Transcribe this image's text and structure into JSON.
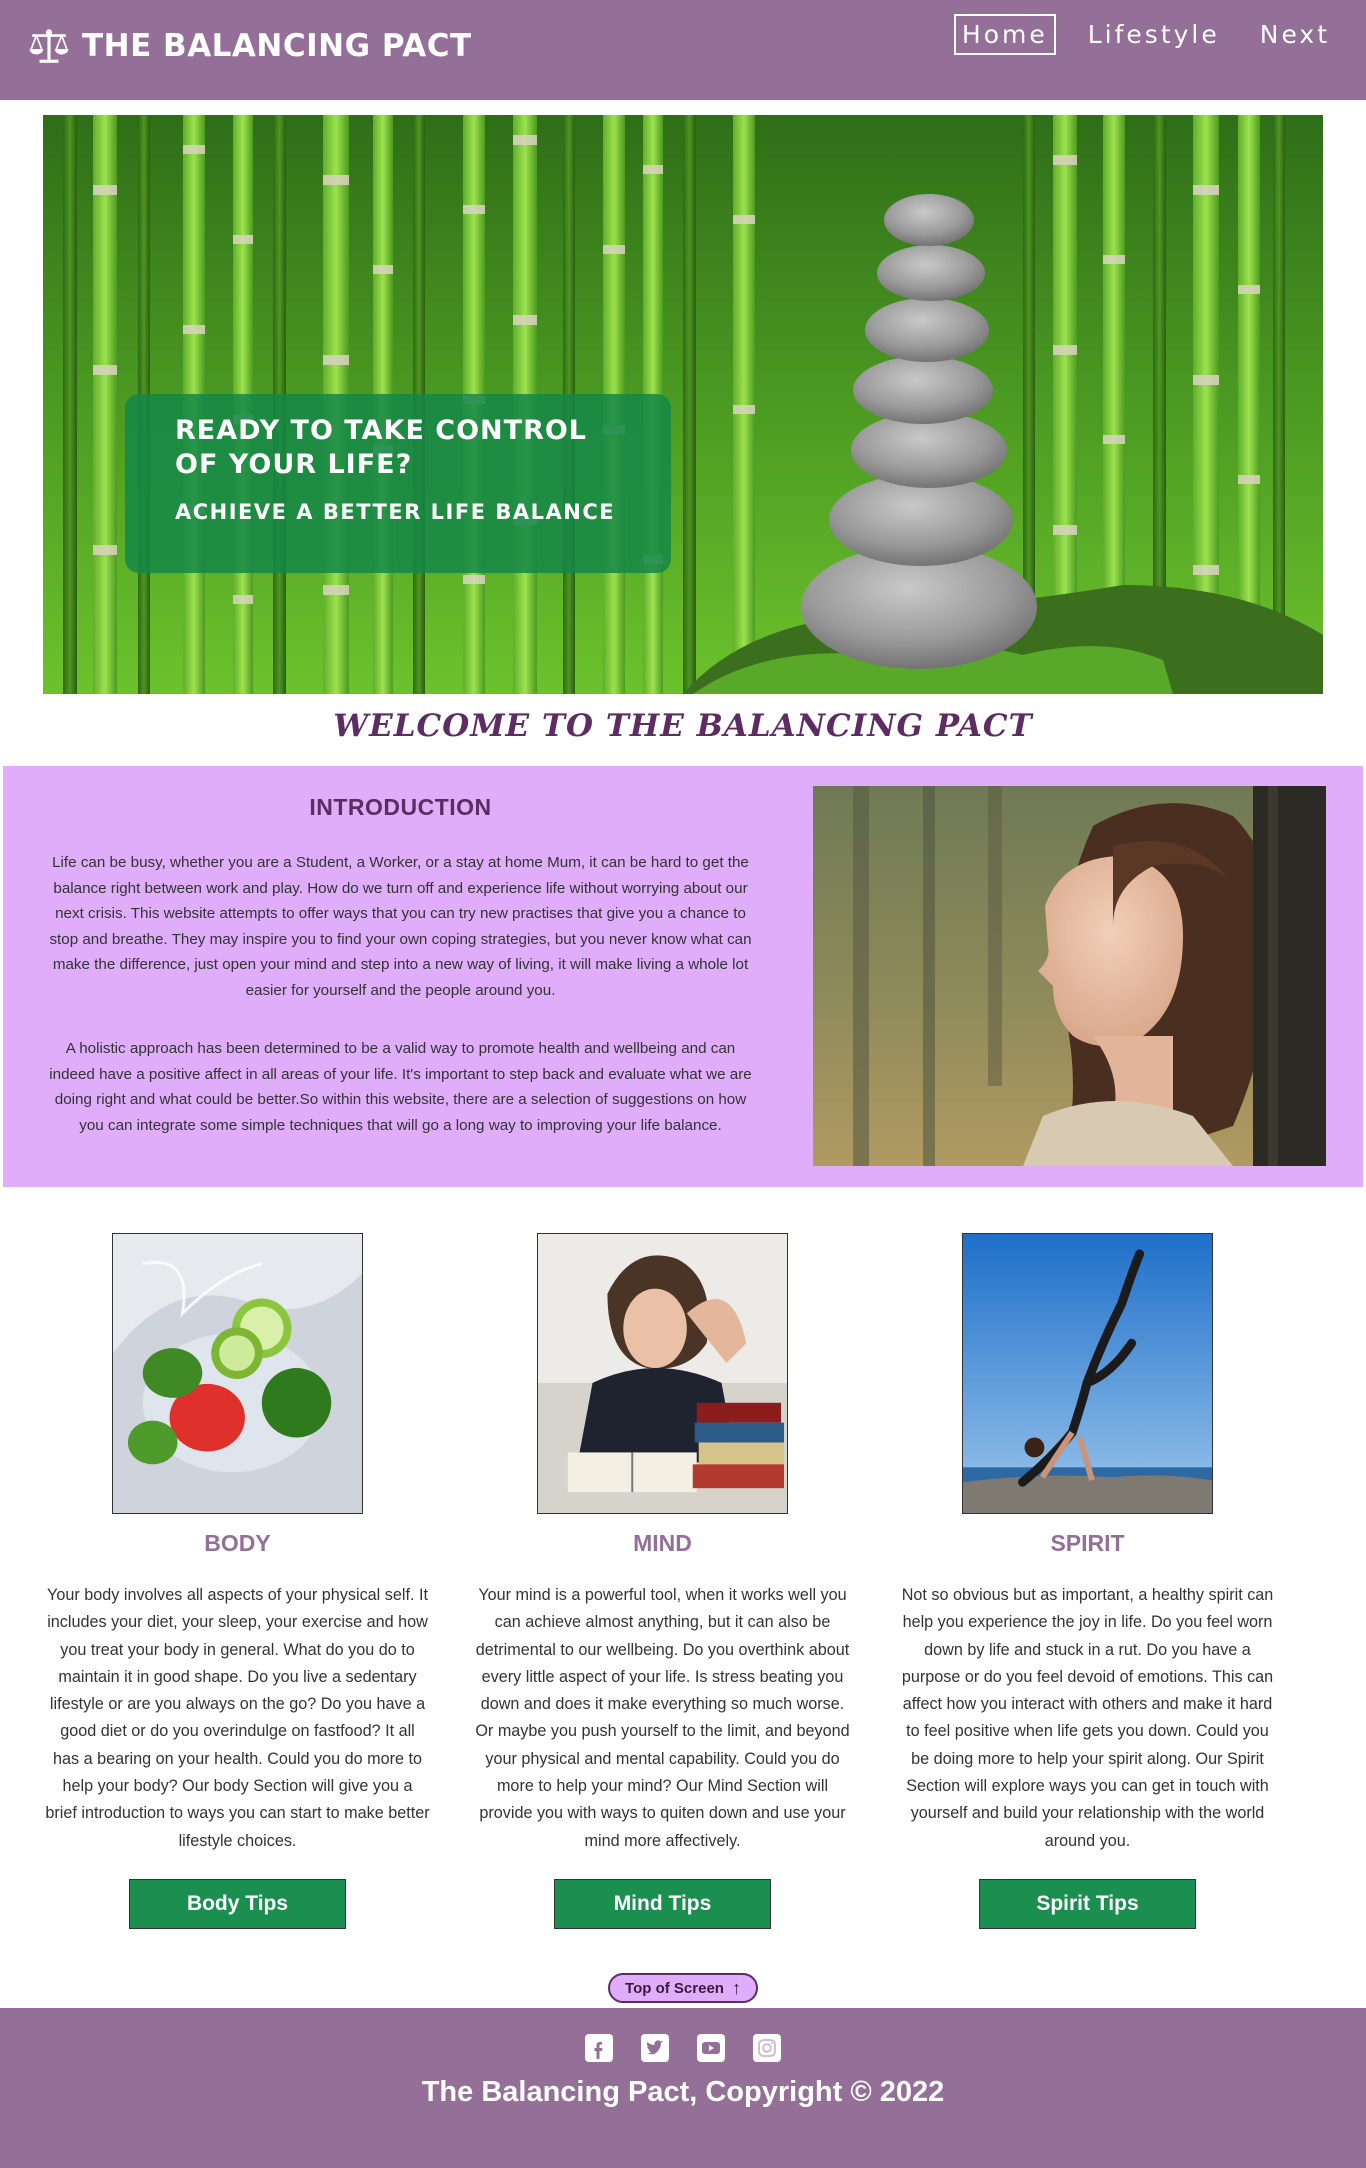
{
  "nav": {
    "brand": "THE BALANCING PACT",
    "brand_icon": "balance-scale-icon",
    "links": [
      {
        "label": "Home",
        "active": true
      },
      {
        "label": "Lifestyle",
        "active": false
      },
      {
        "label": "Next",
        "active": false
      }
    ]
  },
  "hero": {
    "title": "READY TO TAKE CONTROL OF YOUR LIFE?",
    "subtitle": "ACHIEVE A BETTER LIFE BALANCE",
    "image": "stacked zen stones in front of bamboo"
  },
  "welcome": "WELCOME TO THE BALANCING PACT",
  "intro": {
    "title": "INTRODUCTION",
    "paragraphs": [
      "Life can be busy, whether you are a Student, a Worker, or a stay at home Mum, it can be hard to get the balance right between work and play. How do we turn off and experience life without worrying about our next crisis. This website attempts to offer ways that you can try new practises that give you a chance to stop and breathe. They may inspire you to find your own coping strategies, but you never know what can make the difference, just open your mind and step into a new way of living, it will make living a whole lot easier for yourself and the people around you.",
      "A holistic approach has been determined to be a valid way to promote health and wellbeing and can indeed have a positive affect in all areas of your life. It's important to step back and evaluate what we are doing right and what could be better.So within this website, there are a selection of suggestions on how you can integrate some simple techniques that will go a long way to improving your life balance."
    ]
  },
  "cards": [
    {
      "title": "BODY",
      "text": "Your body involves all aspects of your physical self. It includes your diet, your sleep, your exercise and how you treat your body in general. What do you do to maintain it in good shape. Do you live a sedentary lifestyle or are you always on the go? Do you have a good diet or do you overindulge on fastfood? It all has a bearing on your health. Could you do more to help your body? Our body Section will give you a brief introduction to ways you can start to make better lifestyle choices.",
      "button": "Body Tips"
    },
    {
      "title": "MIND",
      "text": "Your mind is a powerful tool, when it works well you can achieve almost anything, but it can also be detrimental to our wellbeing. Do you overthink about every little aspect of your life. Is stress beating you down and does it make everything so much worse. Or maybe you push yourself to the limit, and beyond your physical and mental capability. Could you do more to help your mind? Our Mind Section will provide you with ways to quiten down and use your mind more affectively.",
      "button": "Mind Tips"
    },
    {
      "title": "SPIRIT",
      "text": "Not so obvious but as important, a healthy spirit can help you experience the joy in life. Do you feel worn down by life and stuck in a rut. Do you have a purpose or do you feel devoid of emotions. This can affect how you interact with others and make it hard to feel positive when life gets you down. Could you be doing more to help your spirit along. Our Spirit Section will explore ways you can get in touch with yourself and build your relationship with the world around you.",
      "button": "Spirit Tips"
    }
  ],
  "top_button": {
    "label": "Top of Screen",
    "icon": "arrow-up-icon"
  },
  "footer": {
    "socials": [
      "facebook-icon",
      "twitter-icon",
      "youtube-icon",
      "instagram-icon"
    ],
    "copyright": "The Balancing Pact, Copyright © 2022"
  },
  "colors": {
    "nav_purple": "#946f98",
    "intro_lilac": "#dfadf9",
    "heading_plum": "#5c2c63",
    "button_green": "#1a8f4f",
    "hero_box_green": "#148746"
  }
}
